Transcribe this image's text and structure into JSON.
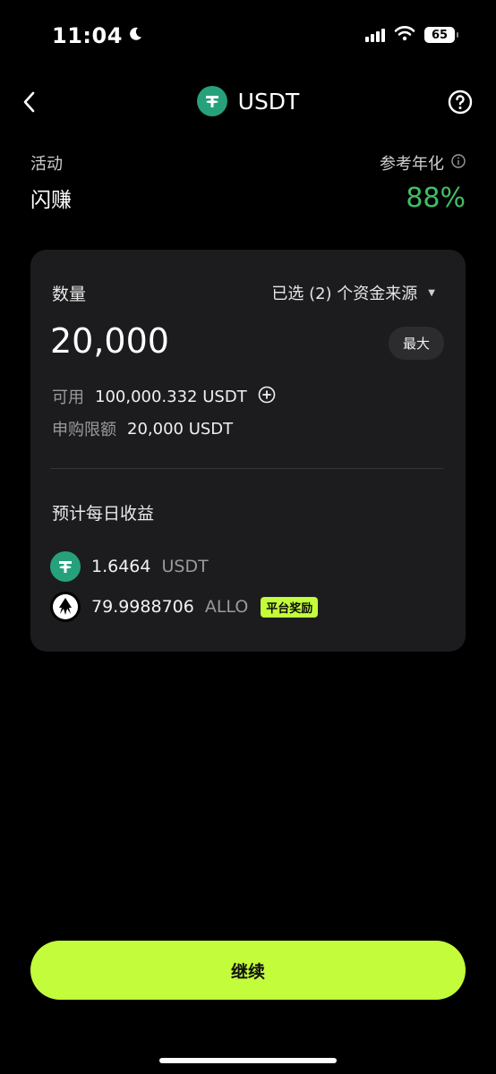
{
  "status_bar": {
    "time": "11:04",
    "battery": "65",
    "icons": [
      "moon-icon",
      "signal-icon",
      "wifi-icon",
      "battery-icon"
    ]
  },
  "header": {
    "title": "USDT",
    "icons": [
      "back-icon",
      "tether-logo",
      "help-icon"
    ]
  },
  "activity": {
    "label": "活动",
    "value": "闪赚"
  },
  "apy": {
    "label": "参考年化",
    "value": "88%",
    "color": "#3fbf66"
  },
  "card": {
    "qty_label": "数量",
    "source_select": "已选 (2) 个资金来源",
    "amount": "20,000",
    "max_label": "最大",
    "available_label": "可用",
    "available_value": "100,000.332 USDT",
    "limit_label": "申购限额",
    "limit_value": "20,000 USDT",
    "daily_label": "预计每日收益",
    "earnings": [
      {
        "amount": "1.6464",
        "unit": "USDT",
        "icon": "tether-logo"
      },
      {
        "amount": "79.9988706",
        "unit": "ALLO",
        "icon": "allo-logo",
        "badge": "平台奖励"
      }
    ]
  },
  "continue_button": "继续",
  "colors": {
    "accent": "#c3fc3a",
    "tether": "#26a17b",
    "background": "#000000",
    "card": "#1c1c1e"
  }
}
